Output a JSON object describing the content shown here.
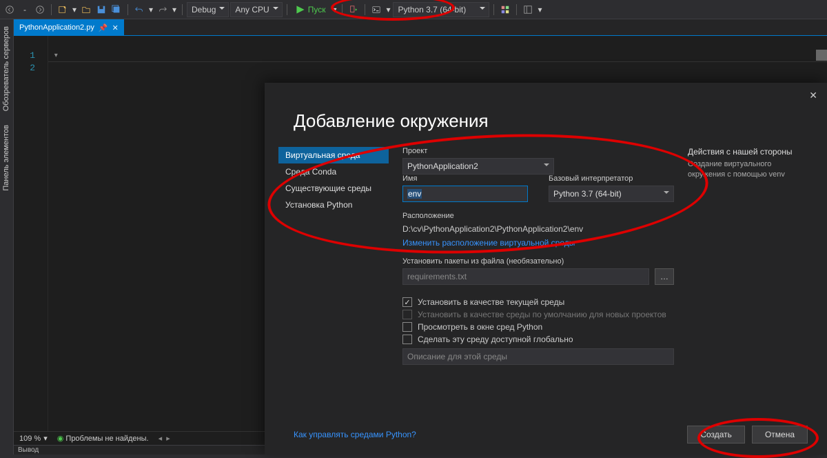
{
  "toolbar": {
    "config": "Debug",
    "platform": "Any CPU",
    "run_label": "Пуск",
    "interpreter": "Python 3.7 (64-bit)"
  },
  "side_tabs": {
    "server_explorer": "Обозреватель серверов",
    "toolbox": "Панель элементов"
  },
  "doc_tab": {
    "filename": "PythonApplication2.py"
  },
  "editor": {
    "line_numbers": [
      "1",
      "2"
    ]
  },
  "status": {
    "zoom": "109 %",
    "problems": "Проблемы не найдены."
  },
  "output_label": "Вывод",
  "modal": {
    "title": "Добавление окружения",
    "nav": {
      "virtualenv": "Виртуальная среда",
      "conda": "Среда Conda",
      "existing": "Существующие среды",
      "install": "Установка Python"
    },
    "fields": {
      "project_label": "Проект",
      "project_value": "PythonApplication2",
      "name_label": "Имя",
      "name_value": "env",
      "base_label": "Базовый интерпретатор",
      "base_value": "Python 3.7 (64-bit)",
      "location_label": "Расположение",
      "location_value": "D:\\cv\\PythonApplication2\\PythonApplication2\\env",
      "change_location_link": "Изменить расположение виртуальной среды",
      "packages_label": "Установить пакеты из файла (необязательно)",
      "packages_placeholder": "requirements.txt",
      "cb_set_current": "Установить в качестве текущей среды",
      "cb_set_default": "Установить в качестве среды по умолчанию для новых проектов",
      "cb_view_window": "Просмотреть в окне сред Python",
      "cb_make_global": "Сделать эту среду доступной глобально",
      "desc_placeholder": "Описание для этой среды"
    },
    "side": {
      "title": "Действия с нашей стороны",
      "body": "Создание виртуального окружения с помощью venv"
    },
    "footer": {
      "help_link": "Как управлять средами Python?",
      "create": "Создать",
      "cancel": "Отмена"
    }
  }
}
